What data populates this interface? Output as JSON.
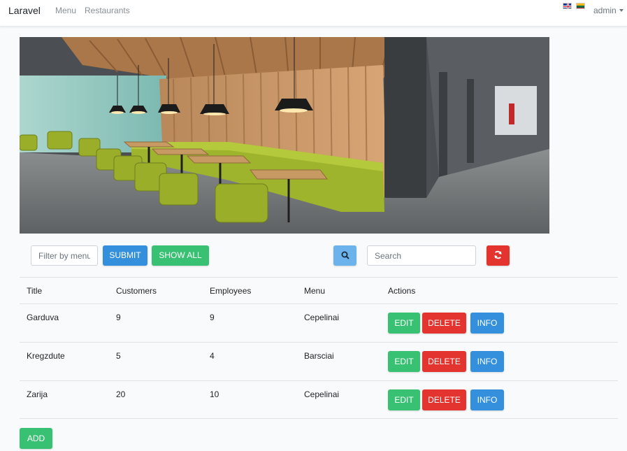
{
  "navbar": {
    "brand": "Laravel",
    "links": [
      "Menu",
      "Restaurants"
    ],
    "user": "admin",
    "flags": [
      "uk-flag",
      "lithuania-flag"
    ]
  },
  "hero": {
    "alt": "restaurant interior photo"
  },
  "toolbar": {
    "filter_placeholder": "Filter by menu",
    "submit_label": "SUBMIT",
    "show_all_label": "SHOW ALL",
    "search_icon": "search-icon",
    "search_placeholder": "Search",
    "refresh_icon": "refresh-icon"
  },
  "table": {
    "headers": [
      "Title",
      "Customers",
      "Employees",
      "Menu",
      "Actions"
    ],
    "rows": [
      {
        "title": "Garduva",
        "customers": "9",
        "employees": "9",
        "menu": "Cepelinai"
      },
      {
        "title": "Kregzdute",
        "customers": "5",
        "employees": "4",
        "menu": "Barsciai"
      },
      {
        "title": "Zarija",
        "customers": "20",
        "employees": "10",
        "menu": "Cepelinai"
      }
    ],
    "actions": {
      "edit": "EDIT",
      "delete": "DELETE",
      "info": "INFO"
    }
  },
  "add_label": "ADD",
  "colors": {
    "primary": "#3490dc",
    "success": "#38c172",
    "danger": "#e3342f",
    "info": "#6cb2eb"
  }
}
